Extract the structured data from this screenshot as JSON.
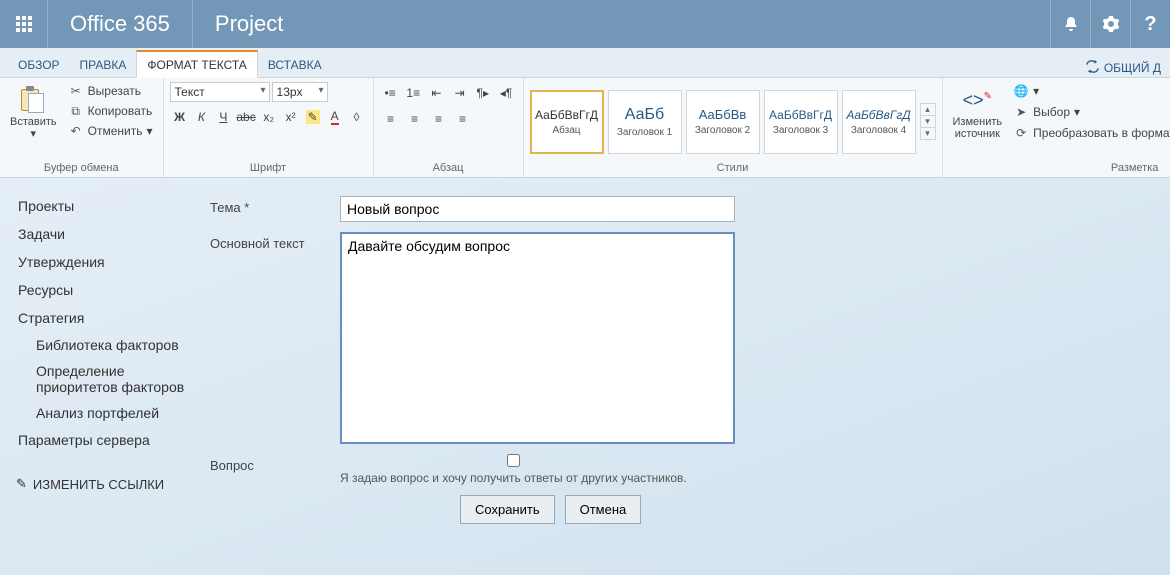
{
  "topbar": {
    "brand": "Office 365",
    "app": "Project"
  },
  "tabs": {
    "items": [
      {
        "label": "ОБЗОР"
      },
      {
        "label": "ПРАВКА"
      },
      {
        "label": "ФОРМАТ ТЕКСТА"
      },
      {
        "label": "ВСТАВКА"
      }
    ],
    "right_label": "ОБЩИЙ Д"
  },
  "ribbon": {
    "clipboard": {
      "paste": "Вставить",
      "cut": "Вырезать",
      "copy": "Копировать",
      "undo": "Отменить",
      "label": "Буфер обмена"
    },
    "font": {
      "font_name": "Текст",
      "font_size": "13px",
      "bold": "Ж",
      "italic": "К",
      "underline": "Ч",
      "strike": "abc",
      "sub": "x₂",
      "sup": "x²",
      "label": "Шрифт"
    },
    "para": {
      "label": "Абзац"
    },
    "styles": {
      "items": [
        {
          "sample": "АаБбВвГгД",
          "name": "Абзац"
        },
        {
          "sample": "АаБб",
          "name": "Заголовок 1"
        },
        {
          "sample": "АаБбВв",
          "name": "Заголовок 2"
        },
        {
          "sample": "АаБбВвГгД",
          "name": "Заголовок 3"
        },
        {
          "sample": "АаБбВвГгД",
          "name": "Заголовок 4"
        }
      ],
      "label": "Стили"
    },
    "markup": {
      "edit_source": "Изменить источник",
      "select": "Выбор",
      "convert": "Преобразовать в формат XHTML",
      "label": "Разметка"
    }
  },
  "sidebar": {
    "items": [
      {
        "label": "Проекты"
      },
      {
        "label": "Задачи"
      },
      {
        "label": "Утверждения"
      },
      {
        "label": "Ресурсы"
      },
      {
        "label": "Стратегия"
      }
    ],
    "sub": [
      {
        "label": "Библиотека факторов"
      },
      {
        "label": "Определение приоритетов факторов"
      },
      {
        "label": "Анализ портфелей"
      }
    ],
    "last": {
      "label": "Параметры сервера"
    },
    "edit": "ИЗМЕНИТЬ ССЫЛКИ"
  },
  "form": {
    "topic_label": "Тема *",
    "topic_value": "Новый вопрос",
    "body_label": "Основной текст",
    "body_value": "Давайте обсудим вопрос",
    "question_label": "Вопрос",
    "question_hint": "Я задаю вопрос и хочу получить ответы от других участников.",
    "save": "Сохранить",
    "cancel": "Отмена"
  }
}
